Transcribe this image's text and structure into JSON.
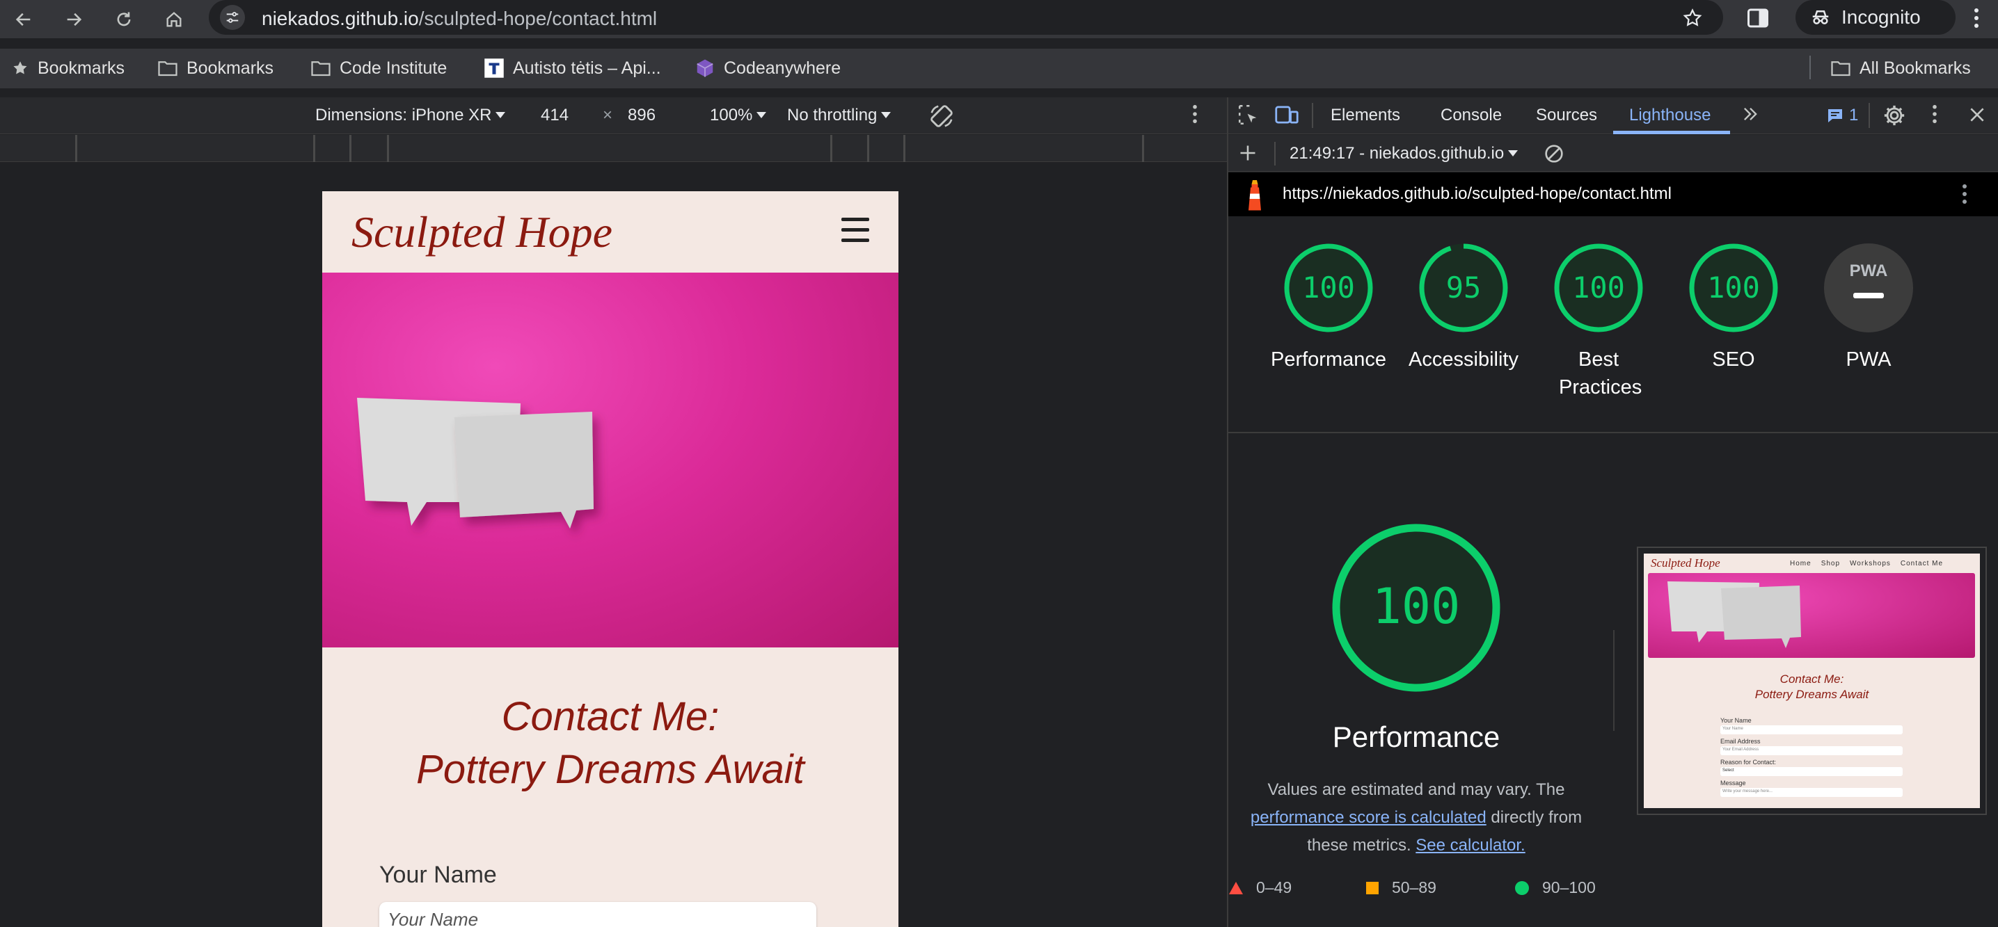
{
  "browser": {
    "url_domain": "niekados.github.io",
    "url_path": "/sculpted-hope/contact.html",
    "profile_label": "Incognito"
  },
  "bookmarks_bar": {
    "items": [
      {
        "label": "Bookmarks",
        "icon": "star-icon"
      },
      {
        "label": "Bookmarks",
        "icon": "folder-icon"
      },
      {
        "label": "Code Institute",
        "icon": "folder-icon"
      },
      {
        "label": "Autisto tėtis – Api...",
        "icon": "site-favicon"
      },
      {
        "label": "Codeanywhere",
        "icon": "cube-icon"
      }
    ],
    "all_bookmarks": "All Bookmarks"
  },
  "device_toolbar": {
    "dimensions": "Dimensions: iPhone XR",
    "width": "414",
    "times": "×",
    "height": "896",
    "zoom": "100%",
    "throttling": "No throttling"
  },
  "page": {
    "logo": "Sculpted Hope",
    "title_line1": "Contact Me:",
    "title_line2": "Pottery Dreams Await",
    "name_label": "Your Name",
    "name_placeholder": "Your Name"
  },
  "devtools": {
    "tabs": [
      "Elements",
      "Console",
      "Sources",
      "Lighthouse"
    ],
    "active_tab": "Lighthouse",
    "issues_count": "1",
    "report_selector": "21:49:17 - niekados.github.io",
    "report_url": "https://niekados.github.io/sculpted-hope/contact.html"
  },
  "lighthouse": {
    "categories": [
      {
        "label": "Performance",
        "score": "100"
      },
      {
        "label": "Accessibility",
        "score": "95"
      },
      {
        "label": "Best Practices",
        "score": "100"
      },
      {
        "label": "SEO",
        "score": "100"
      },
      {
        "label": "PWA",
        "score": ""
      }
    ],
    "pwa_badge": "PWA",
    "main_score": "100",
    "main_title": "Performance",
    "desc_part1": "Values are estimated and may vary. The ",
    "desc_link1": "performance score is calculated",
    "desc_part2": " directly from these metrics. ",
    "desc_link2": "See calculator.",
    "legend": [
      {
        "range": "0–49",
        "color": "#ff4e42"
      },
      {
        "range": "50–89",
        "color": "#ffa400"
      },
      {
        "range": "90–100",
        "color": "#0cce6b"
      }
    ],
    "score_color": "#0cce6b"
  },
  "thumbnail": {
    "logo": "Sculpted Hope",
    "nav": [
      "Home",
      "Shop",
      "Workshops",
      "Contact Me"
    ],
    "title_line1": "Contact Me:",
    "title_line2": "Pottery Dreams Await",
    "fields": [
      "Your Name",
      "Email Address",
      "Reason for Contact:",
      "Message"
    ],
    "field_placeholders": [
      "Your Name",
      "Your Email Address",
      "Select",
      "Write your message here..."
    ]
  }
}
